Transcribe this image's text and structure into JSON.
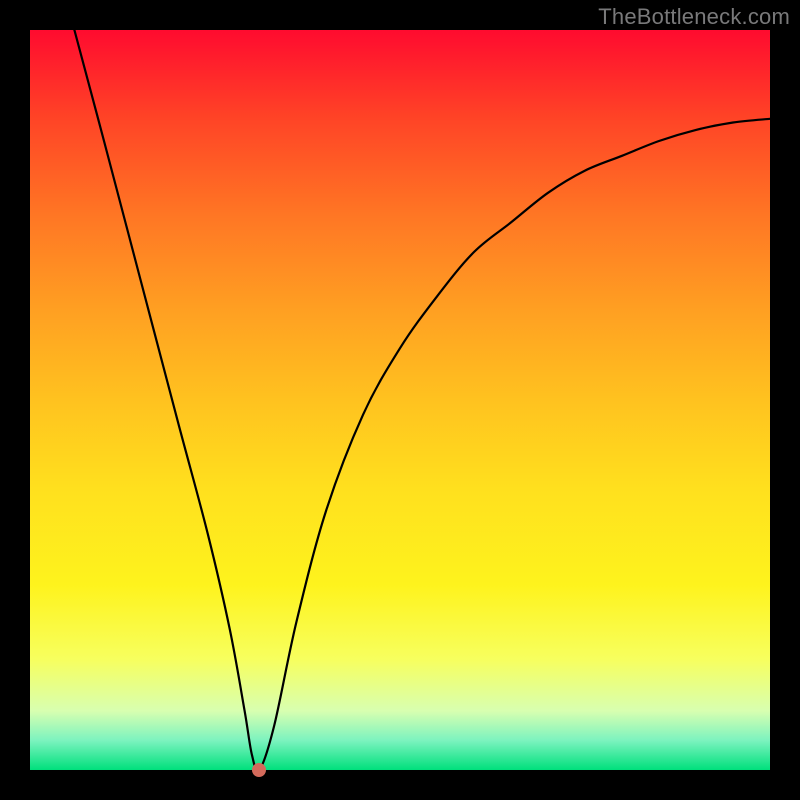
{
  "watermark": "TheBottleneck.com",
  "chart_data": {
    "type": "line",
    "title": "",
    "xlabel": "",
    "ylabel": "",
    "xlim": [
      0,
      100
    ],
    "ylim": [
      0,
      100
    ],
    "grid": false,
    "legend": false,
    "series": [
      {
        "name": "bottleneck-curve",
        "x": [
          6,
          10,
          15,
          20,
          24,
          27,
          29,
          30,
          31,
          33,
          36,
          40,
          45,
          50,
          55,
          60,
          65,
          70,
          75,
          80,
          85,
          90,
          95,
          100
        ],
        "y": [
          100,
          85,
          66,
          47,
          32,
          19,
          8,
          2,
          0,
          6,
          20,
          35,
          48,
          57,
          64,
          70,
          74,
          78,
          81,
          83,
          85,
          86.5,
          87.5,
          88
        ]
      }
    ],
    "markers": [
      {
        "name": "minimum-point",
        "x": 31,
        "y": 0,
        "color": "#d36a5b"
      }
    ],
    "background_gradient": {
      "top": "#ff0b2f",
      "bottom": "#00e07c"
    },
    "curve_color": "#000000"
  }
}
